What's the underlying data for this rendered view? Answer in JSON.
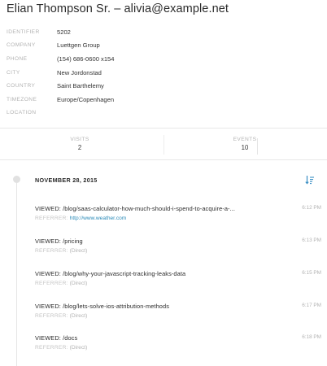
{
  "title": "Elian Thompson Sr. – alivia@example.net",
  "properties": [
    {
      "key": "IDENTIFIER",
      "value": "5202"
    },
    {
      "key": "COMPANY",
      "value": "Luettgen Group"
    },
    {
      "key": "PHONE",
      "value": "(154) 686-0600 x154"
    },
    {
      "key": "CITY",
      "value": "New Jordonstad"
    },
    {
      "key": "COUNTRY",
      "value": "Saint Barthelemy"
    },
    {
      "key": "TIMEZONE",
      "value": "Europe/Copenhagen"
    },
    {
      "key": "LOCATION",
      "value": ""
    }
  ],
  "stats": {
    "visits": {
      "label": "VISITS",
      "value": "2"
    },
    "events": {
      "label": "EVENTS",
      "value": "10"
    }
  },
  "timeline": {
    "date": "NOVEMBER 28, 2015",
    "sort_icon": "sort-descending-icon",
    "events": [
      {
        "prefix": "VIEWED:",
        "path": "/blog/saas-calculator-how-much-should-i-spend-to-acquire-a-...",
        "time": "6:12 PM",
        "referrer_label": "REFERRER:",
        "referrer": "http://www.weather.com",
        "referrer_is_link": true
      },
      {
        "prefix": "VIEWED:",
        "path": "/pricing",
        "time": "6:13 PM",
        "referrer_label": "REFERRER:",
        "referrer": "(Direct)",
        "referrer_is_link": false
      },
      {
        "prefix": "VIEWED:",
        "path": "/blog/why-your-javascript-tracking-leaks-data",
        "time": "6:15 PM",
        "referrer_label": "REFERRER:",
        "referrer": "(Direct)",
        "referrer_is_link": false
      },
      {
        "prefix": "VIEWED:",
        "path": "/blog/lets-solve-ios-attribution-methods",
        "time": "6:17 PM",
        "referrer_label": "REFERRER:",
        "referrer": "(Direct)",
        "referrer_is_link": false
      },
      {
        "prefix": "VIEWED:",
        "path": "/docs",
        "time": "6:18 PM",
        "referrer_label": "REFERRER:",
        "referrer": "(Direct)",
        "referrer_is_link": false
      }
    ]
  },
  "colors": {
    "link": "#2a8ab8",
    "muted": "#b3b3b3",
    "text": "#2b2b2b",
    "sort_icon": "#3a8fc4"
  }
}
